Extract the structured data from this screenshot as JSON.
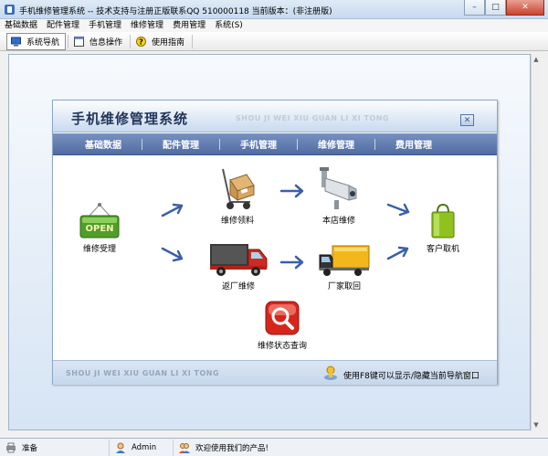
{
  "window": {
    "title": "手机维修管理系统 -- 技术支持与注册正版联系QQ 510000118   当前版本：(非注册版)",
    "minimize_glyph": "–",
    "maximize_glyph": "□",
    "close_glyph": "✕"
  },
  "menu": [
    "基础数据",
    "配件管理",
    "手机管理",
    "维修管理",
    "费用管理",
    "系统(S)"
  ],
  "toolbar": {
    "items": [
      {
        "label": "系统导航",
        "icon": "monitor-icon",
        "active": true
      },
      {
        "label": "信息操作",
        "icon": "window-icon",
        "active": false
      },
      {
        "label": "使用指南",
        "icon": "help-icon",
        "active": false
      }
    ]
  },
  "panel": {
    "title": "手机维修管理系统",
    "pinyin": "SHOU JI WEI XIU GUAN LI XI TONG",
    "close_glyph": "✕",
    "nav": [
      "基础数据",
      "配件管理",
      "手机管理",
      "维修管理",
      "费用管理"
    ],
    "footer_pinyin": "SHOU JI WEI XIU GUAN LI XI TONG",
    "footer_hint": "使用F8键可以显示/隐藏当前导航窗口"
  },
  "flow": {
    "open_sign": "OPEN",
    "nodes": {
      "intake": "维修受理",
      "parts": "维修领料",
      "shop_repair": "本店维修",
      "return_factory": "返厂维修",
      "factory_pickup": "厂家取回",
      "customer_pickup": "客户取机",
      "status_query": "维修状态查询"
    }
  },
  "statusbar": {
    "ready": "准备",
    "user": "Admin",
    "welcome": "欢迎使用我们的产品!"
  },
  "colors": {
    "nav_bar": "#5f7bb0",
    "panel_border": "#8ea7c8",
    "arrow_blue": "#3b5fa8"
  }
}
